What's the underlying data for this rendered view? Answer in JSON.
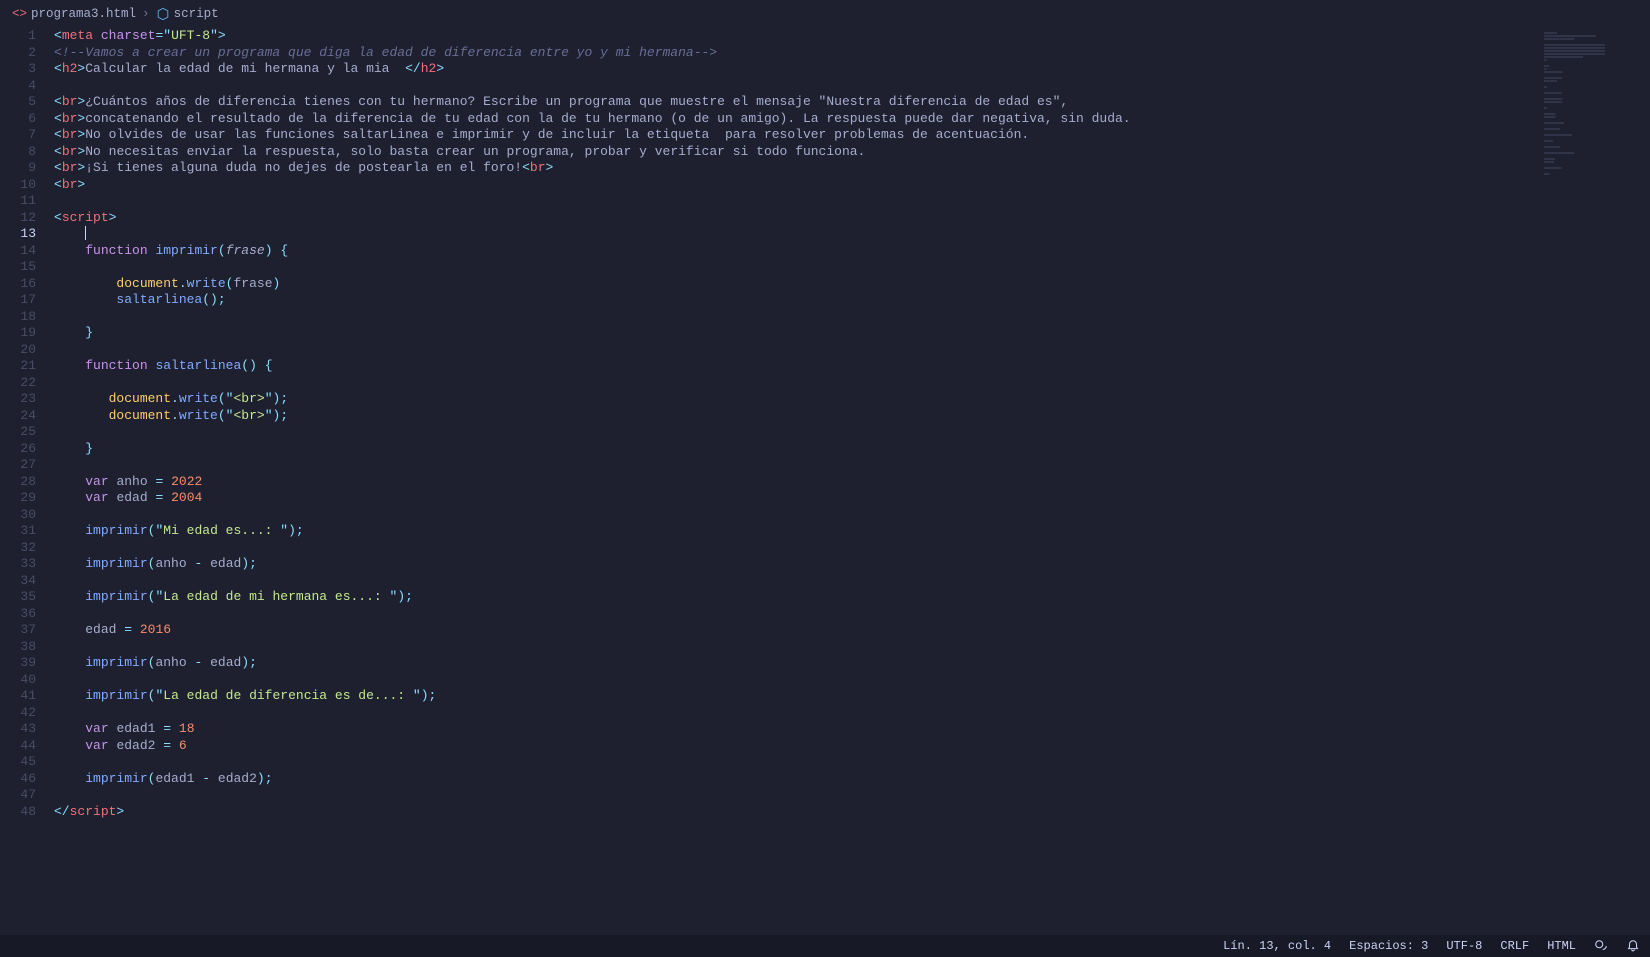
{
  "breadcrumb": {
    "file": "programa3.html",
    "symbol": "script"
  },
  "cursor_line": 13,
  "code": {
    "lines": [
      {
        "n": 1,
        "seg": [
          [
            "k-punc",
            "<"
          ],
          [
            "k-tag",
            "meta"
          ],
          [
            "k-text",
            " "
          ],
          [
            "k-key",
            "charset"
          ],
          [
            "k-op",
            "="
          ],
          [
            "k-punc",
            "\""
          ],
          [
            "k-str",
            "UFT-8"
          ],
          [
            "k-punc",
            "\""
          ],
          [
            "k-punc",
            ">"
          ]
        ]
      },
      {
        "n": 2,
        "seg": [
          [
            "k-comment",
            "<!--Vamos a crear un programa que diga la edad de diferencia entre yo y mi hermana-->"
          ]
        ]
      },
      {
        "n": 3,
        "seg": [
          [
            "k-punc",
            "<"
          ],
          [
            "k-tag",
            "h2"
          ],
          [
            "k-punc",
            ">"
          ],
          [
            "k-text",
            "Calcular la edad de mi hermana y la mia  "
          ],
          [
            "k-punc",
            "</"
          ],
          [
            "k-tag",
            "h2"
          ],
          [
            "k-punc",
            ">"
          ]
        ]
      },
      {
        "n": 4,
        "seg": []
      },
      {
        "n": 5,
        "seg": [
          [
            "k-punc",
            "<"
          ],
          [
            "k-tag",
            "br"
          ],
          [
            "k-punc",
            ">"
          ],
          [
            "k-text",
            "¿Cuántos años de diferencia tienes con tu hermano? Escribe un programa que muestre el mensaje \"Nuestra diferencia de edad es\","
          ]
        ]
      },
      {
        "n": 6,
        "seg": [
          [
            "k-punc",
            "<"
          ],
          [
            "k-tag",
            "br"
          ],
          [
            "k-punc",
            ">"
          ],
          [
            "k-text",
            "concatenando el resultado de la diferencia de tu edad con la de tu hermano (o de un amigo). La respuesta puede dar negativa, sin duda."
          ]
        ]
      },
      {
        "n": 7,
        "seg": [
          [
            "k-punc",
            "<"
          ],
          [
            "k-tag",
            "br"
          ],
          [
            "k-punc",
            ">"
          ],
          [
            "k-text",
            "No olvides de usar las funciones saltarLinea e imprimir y de incluir la etiqueta  para resolver problemas de acentuación."
          ]
        ]
      },
      {
        "n": 8,
        "seg": [
          [
            "k-punc",
            "<"
          ],
          [
            "k-tag",
            "br"
          ],
          [
            "k-punc",
            ">"
          ],
          [
            "k-text",
            "No necesitas enviar la respuesta, solo basta crear un programa, probar y verificar si todo funciona."
          ]
        ]
      },
      {
        "n": 9,
        "seg": [
          [
            "k-punc",
            "<"
          ],
          [
            "k-tag",
            "br"
          ],
          [
            "k-punc",
            ">"
          ],
          [
            "k-text",
            "¡Si tienes alguna duda no dejes de postearla en el foro!"
          ],
          [
            "k-punc",
            "<"
          ],
          [
            "k-tag",
            "br"
          ],
          [
            "k-punc",
            ">"
          ]
        ]
      },
      {
        "n": 10,
        "seg": [
          [
            "k-punc",
            "<"
          ],
          [
            "k-tag",
            "br"
          ],
          [
            "k-punc",
            ">"
          ]
        ]
      },
      {
        "n": 11,
        "seg": []
      },
      {
        "n": 12,
        "seg": [
          [
            "k-punc",
            "<"
          ],
          [
            "k-tag",
            "script"
          ],
          [
            "k-punc",
            ">"
          ]
        ]
      },
      {
        "n": 13,
        "indent": "    ",
        "cursor": true,
        "seg": []
      },
      {
        "n": 14,
        "indent": "    ",
        "seg": [
          [
            "k-key",
            "function"
          ],
          [
            "k-text",
            " "
          ],
          [
            "k-func",
            "imprimir"
          ],
          [
            "k-punc",
            "("
          ],
          [
            "k-param",
            "frase"
          ],
          [
            "k-punc",
            ")"
          ],
          [
            "k-text",
            " "
          ],
          [
            "k-punc",
            "{"
          ]
        ]
      },
      {
        "n": 15,
        "seg": []
      },
      {
        "n": 16,
        "indent": "        ",
        "seg": [
          [
            "k-doc",
            "document"
          ],
          [
            "k-punc",
            "."
          ],
          [
            "k-func",
            "write"
          ],
          [
            "k-punc",
            "("
          ],
          [
            "k-var",
            "frase"
          ],
          [
            "k-punc",
            ")"
          ]
        ]
      },
      {
        "n": 17,
        "indent": "        ",
        "seg": [
          [
            "k-func",
            "saltarlinea"
          ],
          [
            "k-punc",
            "()"
          ],
          [
            "k-punc",
            ";"
          ]
        ]
      },
      {
        "n": 18,
        "seg": []
      },
      {
        "n": 19,
        "indent": "    ",
        "seg": [
          [
            "k-punc",
            "}"
          ]
        ]
      },
      {
        "n": 20,
        "seg": []
      },
      {
        "n": 21,
        "indent": "    ",
        "seg": [
          [
            "k-key",
            "function"
          ],
          [
            "k-text",
            " "
          ],
          [
            "k-func",
            "saltarlinea"
          ],
          [
            "k-punc",
            "()"
          ],
          [
            "k-text",
            " "
          ],
          [
            "k-punc",
            "{"
          ]
        ]
      },
      {
        "n": 22,
        "seg": []
      },
      {
        "n": 23,
        "indent": "       ",
        "seg": [
          [
            "k-doc",
            "document"
          ],
          [
            "k-punc",
            "."
          ],
          [
            "k-func",
            "write"
          ],
          [
            "k-punc",
            "("
          ],
          [
            "k-punc",
            "\""
          ],
          [
            "k-str",
            "<br>"
          ],
          [
            "k-punc",
            "\""
          ],
          [
            "k-punc",
            ")"
          ],
          [
            "k-punc",
            ";"
          ]
        ]
      },
      {
        "n": 24,
        "indent": "       ",
        "seg": [
          [
            "k-doc",
            "document"
          ],
          [
            "k-punc",
            "."
          ],
          [
            "k-func",
            "write"
          ],
          [
            "k-punc",
            "("
          ],
          [
            "k-punc",
            "\""
          ],
          [
            "k-str",
            "<br>"
          ],
          [
            "k-punc",
            "\""
          ],
          [
            "k-punc",
            ")"
          ],
          [
            "k-punc",
            ";"
          ]
        ]
      },
      {
        "n": 25,
        "seg": []
      },
      {
        "n": 26,
        "indent": "    ",
        "seg": [
          [
            "k-punc",
            "}"
          ]
        ]
      },
      {
        "n": 27,
        "seg": []
      },
      {
        "n": 28,
        "indent": "    ",
        "seg": [
          [
            "k-key",
            "var"
          ],
          [
            "k-text",
            " "
          ],
          [
            "k-var",
            "anho"
          ],
          [
            "k-text",
            " "
          ],
          [
            "k-op",
            "="
          ],
          [
            "k-text",
            " "
          ],
          [
            "k-num",
            "2022"
          ]
        ]
      },
      {
        "n": 29,
        "indent": "    ",
        "seg": [
          [
            "k-key",
            "var"
          ],
          [
            "k-text",
            " "
          ],
          [
            "k-var",
            "edad"
          ],
          [
            "k-text",
            " "
          ],
          [
            "k-op",
            "="
          ],
          [
            "k-text",
            " "
          ],
          [
            "k-num",
            "2004"
          ]
        ]
      },
      {
        "n": 30,
        "seg": []
      },
      {
        "n": 31,
        "indent": "    ",
        "seg": [
          [
            "k-func",
            "imprimir"
          ],
          [
            "k-punc",
            "("
          ],
          [
            "k-punc",
            "\""
          ],
          [
            "k-str",
            "Mi edad es...: "
          ],
          [
            "k-punc",
            "\""
          ],
          [
            "k-punc",
            ")"
          ],
          [
            "k-punc",
            ";"
          ]
        ]
      },
      {
        "n": 32,
        "seg": []
      },
      {
        "n": 33,
        "indent": "    ",
        "seg": [
          [
            "k-func",
            "imprimir"
          ],
          [
            "k-punc",
            "("
          ],
          [
            "k-var",
            "anho"
          ],
          [
            "k-text",
            " "
          ],
          [
            "k-op",
            "-"
          ],
          [
            "k-text",
            " "
          ],
          [
            "k-var",
            "edad"
          ],
          [
            "k-punc",
            ")"
          ],
          [
            "k-punc",
            ";"
          ]
        ]
      },
      {
        "n": 34,
        "seg": []
      },
      {
        "n": 35,
        "indent": "    ",
        "seg": [
          [
            "k-func",
            "imprimir"
          ],
          [
            "k-punc",
            "("
          ],
          [
            "k-punc",
            "\""
          ],
          [
            "k-str",
            "La edad de mi hermana es...: "
          ],
          [
            "k-punc",
            "\""
          ],
          [
            "k-punc",
            ")"
          ],
          [
            "k-punc",
            ";"
          ]
        ]
      },
      {
        "n": 36,
        "seg": []
      },
      {
        "n": 37,
        "indent": "    ",
        "seg": [
          [
            "k-var",
            "edad"
          ],
          [
            "k-text",
            " "
          ],
          [
            "k-op",
            "="
          ],
          [
            "k-text",
            " "
          ],
          [
            "k-num",
            "2016"
          ]
        ]
      },
      {
        "n": 38,
        "seg": []
      },
      {
        "n": 39,
        "indent": "    ",
        "seg": [
          [
            "k-func",
            "imprimir"
          ],
          [
            "k-punc",
            "("
          ],
          [
            "k-var",
            "anho"
          ],
          [
            "k-text",
            " "
          ],
          [
            "k-op",
            "-"
          ],
          [
            "k-text",
            " "
          ],
          [
            "k-var",
            "edad"
          ],
          [
            "k-punc",
            ")"
          ],
          [
            "k-punc",
            ";"
          ]
        ]
      },
      {
        "n": 40,
        "seg": []
      },
      {
        "n": 41,
        "indent": "    ",
        "seg": [
          [
            "k-func",
            "imprimir"
          ],
          [
            "k-punc",
            "("
          ],
          [
            "k-punc",
            "\""
          ],
          [
            "k-str",
            "La edad de diferencia es de...: "
          ],
          [
            "k-punc",
            "\""
          ],
          [
            "k-punc",
            ")"
          ],
          [
            "k-punc",
            ";"
          ]
        ]
      },
      {
        "n": 42,
        "seg": []
      },
      {
        "n": 43,
        "indent": "    ",
        "seg": [
          [
            "k-key",
            "var"
          ],
          [
            "k-text",
            " "
          ],
          [
            "k-var",
            "edad1"
          ],
          [
            "k-text",
            " "
          ],
          [
            "k-op",
            "="
          ],
          [
            "k-text",
            " "
          ],
          [
            "k-num",
            "18"
          ]
        ]
      },
      {
        "n": 44,
        "indent": "    ",
        "seg": [
          [
            "k-key",
            "var"
          ],
          [
            "k-text",
            " "
          ],
          [
            "k-var",
            "edad2"
          ],
          [
            "k-text",
            " "
          ],
          [
            "k-op",
            "="
          ],
          [
            "k-text",
            " "
          ],
          [
            "k-num",
            "6"
          ]
        ]
      },
      {
        "n": 45,
        "seg": []
      },
      {
        "n": 46,
        "indent": "    ",
        "seg": [
          [
            "k-func",
            "imprimir"
          ],
          [
            "k-punc",
            "("
          ],
          [
            "k-var",
            "edad1"
          ],
          [
            "k-text",
            " "
          ],
          [
            "k-op",
            "-"
          ],
          [
            "k-text",
            " "
          ],
          [
            "k-var",
            "edad2"
          ],
          [
            "k-punc",
            ")"
          ],
          [
            "k-punc",
            ";"
          ]
        ]
      },
      {
        "n": 47,
        "seg": []
      },
      {
        "n": 48,
        "seg": [
          [
            "k-punc",
            "</"
          ],
          [
            "k-tag",
            "script"
          ],
          [
            "k-punc",
            ">"
          ]
        ]
      }
    ]
  },
  "statusbar": {
    "position": "Lín. 13, col. 4",
    "spaces": "Espacios: 3",
    "encoding": "UTF-8",
    "eol": "CRLF",
    "language": "HTML"
  }
}
